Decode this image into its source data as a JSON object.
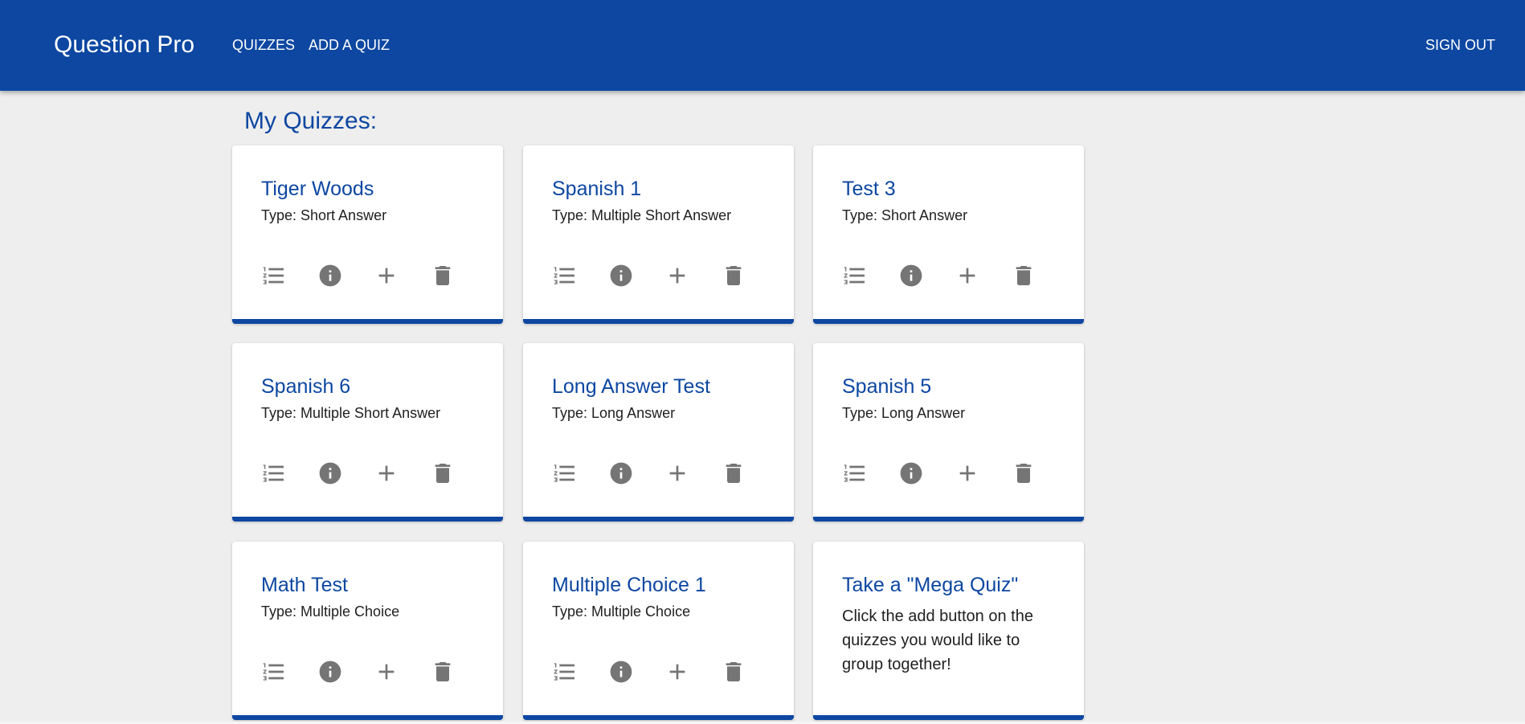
{
  "app": {
    "title": "Question Pro",
    "nav": {
      "quizzes": "QUIZZES",
      "add_quiz": "ADD A QUIZ",
      "sign_out": "SIGN OUT"
    },
    "accent_color": "#0d47a1"
  },
  "page": {
    "title": "My Quizzes:"
  },
  "quizzes": [
    {
      "title": "Tiger Woods",
      "type": "Type: Short Answer"
    },
    {
      "title": "Spanish 1",
      "type": "Type: Multiple Short Answer"
    },
    {
      "title": "Test 3",
      "type": "Type: Short Answer"
    },
    {
      "title": "Spanish 6",
      "type": "Type: Multiple Short Answer"
    },
    {
      "title": "Long Answer Test",
      "type": "Type: Long Answer"
    },
    {
      "title": "Spanish 5",
      "type": "Type: Long Answer"
    },
    {
      "title": "Math Test",
      "type": "Type: Multiple Choice"
    },
    {
      "title": "Multiple Choice 1",
      "type": "Type: Multiple Choice"
    }
  ],
  "mega_quiz": {
    "title": "Take a \"Mega Quiz\"",
    "text": "Click the add button on the quizzes you would like to group together!"
  },
  "card_actions": {
    "icons": [
      "format-list-numbered-icon",
      "info-icon",
      "plus-icon",
      "trash-icon"
    ],
    "icon_color": "#757575"
  }
}
